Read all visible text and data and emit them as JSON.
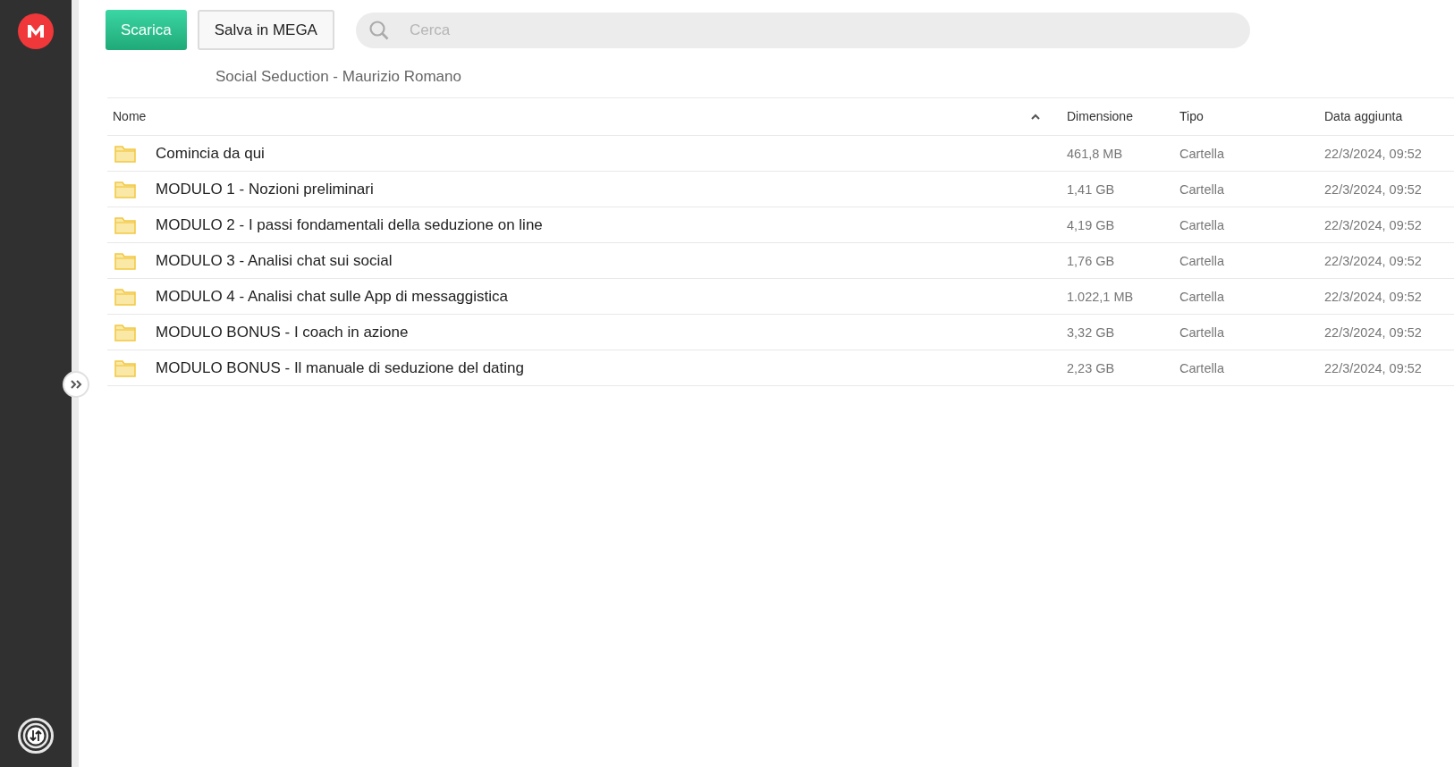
{
  "toolbar": {
    "buttons": [
      {
        "kind": "primary",
        "label": "Scarica"
      },
      {
        "kind": "secondary",
        "label": "Salva in MEGA"
      }
    ],
    "search": {
      "placeholder": "Cerca"
    }
  },
  "breadcrumb": "Social Seduction - Maurizio Romano",
  "table": {
    "sort_ascending": true,
    "columns": [
      "Nome",
      "Dimensione",
      "Tipo",
      "Data aggiunta"
    ],
    "rows": [
      {
        "name": "Comincia da qui",
        "size": "461,8 MB",
        "type": "Cartella",
        "date": "22/3/2024, 09:52"
      },
      {
        "name": "MODULO 1 - Nozioni preliminari",
        "size": "1,41 GB",
        "type": "Cartella",
        "date": "22/3/2024, 09:52"
      },
      {
        "name": "MODULO 2 - I passi fondamentali della seduzione on line",
        "size": "4,19 GB",
        "type": "Cartella",
        "date": "22/3/2024, 09:52"
      },
      {
        "name": "MODULO 3 - Analisi chat sui social",
        "size": "1,76 GB",
        "type": "Cartella",
        "date": "22/3/2024, 09:52"
      },
      {
        "name": "MODULO 4 - Analisi chat sulle App di messaggistica",
        "size": "1.022,1 MB",
        "type": "Cartella",
        "date": "22/3/2024, 09:52"
      },
      {
        "name": "MODULO BONUS - I coach in azione",
        "size": "3,32 GB",
        "type": "Cartella",
        "date": "22/3/2024, 09:52"
      },
      {
        "name": "MODULO BONUS - Il manuale di seduzione del dating",
        "size": "2,23 GB",
        "type": "Cartella",
        "date": "22/3/2024, 09:52"
      }
    ]
  }
}
